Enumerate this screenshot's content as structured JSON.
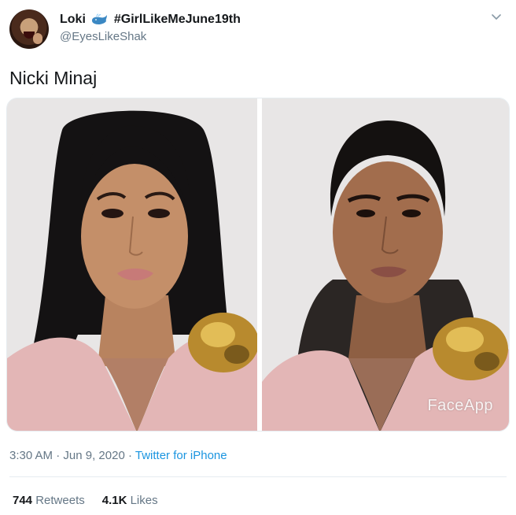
{
  "author": {
    "display_name": "Loki",
    "hashtag": "#GirlLikeMeJune19th",
    "handle": "@EyesLikeShak"
  },
  "tweet": {
    "text": "Nicki Minaj",
    "watermark": "FaceApp",
    "time": "3:30 AM",
    "date": "Jun 9, 2020",
    "source": "Twitter for iPhone",
    "separator": "·"
  },
  "stats": {
    "retweets_count": "744",
    "retweets_label": "Retweets",
    "likes_count": "4.1K",
    "likes_label": "Likes"
  },
  "icons": {
    "badge": "whale-icon",
    "menu": "chevron-down-icon"
  },
  "colors": {
    "link": "#1b95e0",
    "secondary_text": "#657786",
    "primary_text": "#14171a",
    "whale": "#3b88c3"
  }
}
